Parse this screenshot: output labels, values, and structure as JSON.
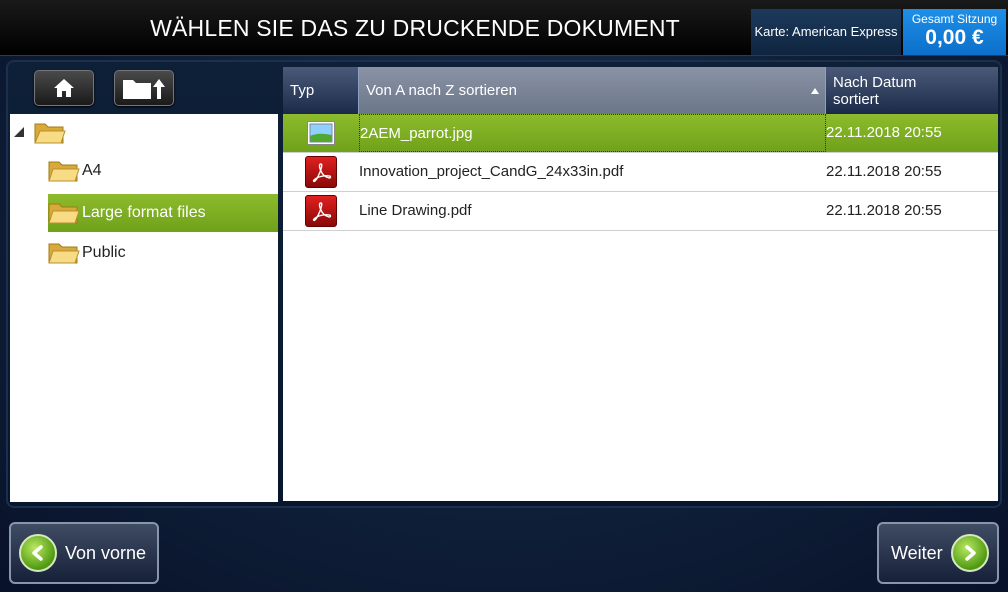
{
  "header": {
    "title": "WÄHLEN SIE DAS ZU DRUCKENDE DOKUMENT",
    "card": "Karte: American Express",
    "session_label": "Gesamt Sitzung",
    "session_amount": "0,00 €"
  },
  "toolbar": {
    "home_icon": "home-icon",
    "folder_up_icon": "folder-up-icon"
  },
  "tree": {
    "root_label": "",
    "items": [
      {
        "label": "A4",
        "selected": false
      },
      {
        "label": "Large format files",
        "selected": true
      },
      {
        "label": "Public",
        "selected": false
      }
    ]
  },
  "table": {
    "headers": {
      "type": "Typ",
      "name": "Von A nach Z sortieren",
      "date_line1": "Nach Datum",
      "date_line2": "sortiert"
    },
    "rows": [
      {
        "icon": "image-icon",
        "name": "2AEM_parrot.jpg",
        "date": "22.11.2018 20:55",
        "selected": true
      },
      {
        "icon": "pdf-icon",
        "name": "Innovation_project_CandG_24x33in.pdf",
        "date": "22.11.2018 20:55",
        "selected": false
      },
      {
        "icon": "pdf-icon",
        "name": "Line Drawing.pdf",
        "date": "22.11.2018 20:55",
        "selected": false
      }
    ]
  },
  "footer": {
    "back_label": "Von vorne",
    "next_label": "Weiter"
  },
  "colors": {
    "accent_green": "#7fb022",
    "session_blue": "#1480db"
  }
}
